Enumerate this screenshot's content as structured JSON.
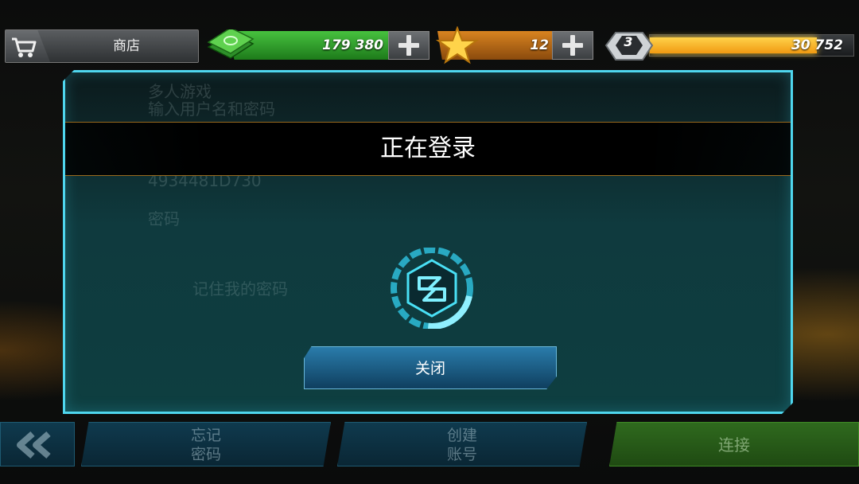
{
  "topbar": {
    "shop_label": "商店",
    "cash_value": "179 380",
    "gold_value": "12",
    "rank_level": "3",
    "rp_value": "30 752",
    "rp_progress": 0.82
  },
  "background_form": {
    "header_line1": "多人游戏",
    "header_line2": "输入用户名和密码",
    "username_value": "4934481D730",
    "password_label": "密码",
    "remember_label": "记住我的密码"
  },
  "modal": {
    "title": "正在登录",
    "close_label": "关闭"
  },
  "bottom_nav": {
    "forgot_line1": "忘记",
    "forgot_line2": "密码",
    "create_line1": "创建",
    "create_line2": "账号",
    "connect_label": "连接"
  },
  "colors": {
    "modal_border": "#4fd6ee",
    "cash_green": "#2fa22a",
    "gold_orange": "#d98420",
    "rp_yellow": "#f6b321",
    "button_blue": "#1e6690"
  }
}
